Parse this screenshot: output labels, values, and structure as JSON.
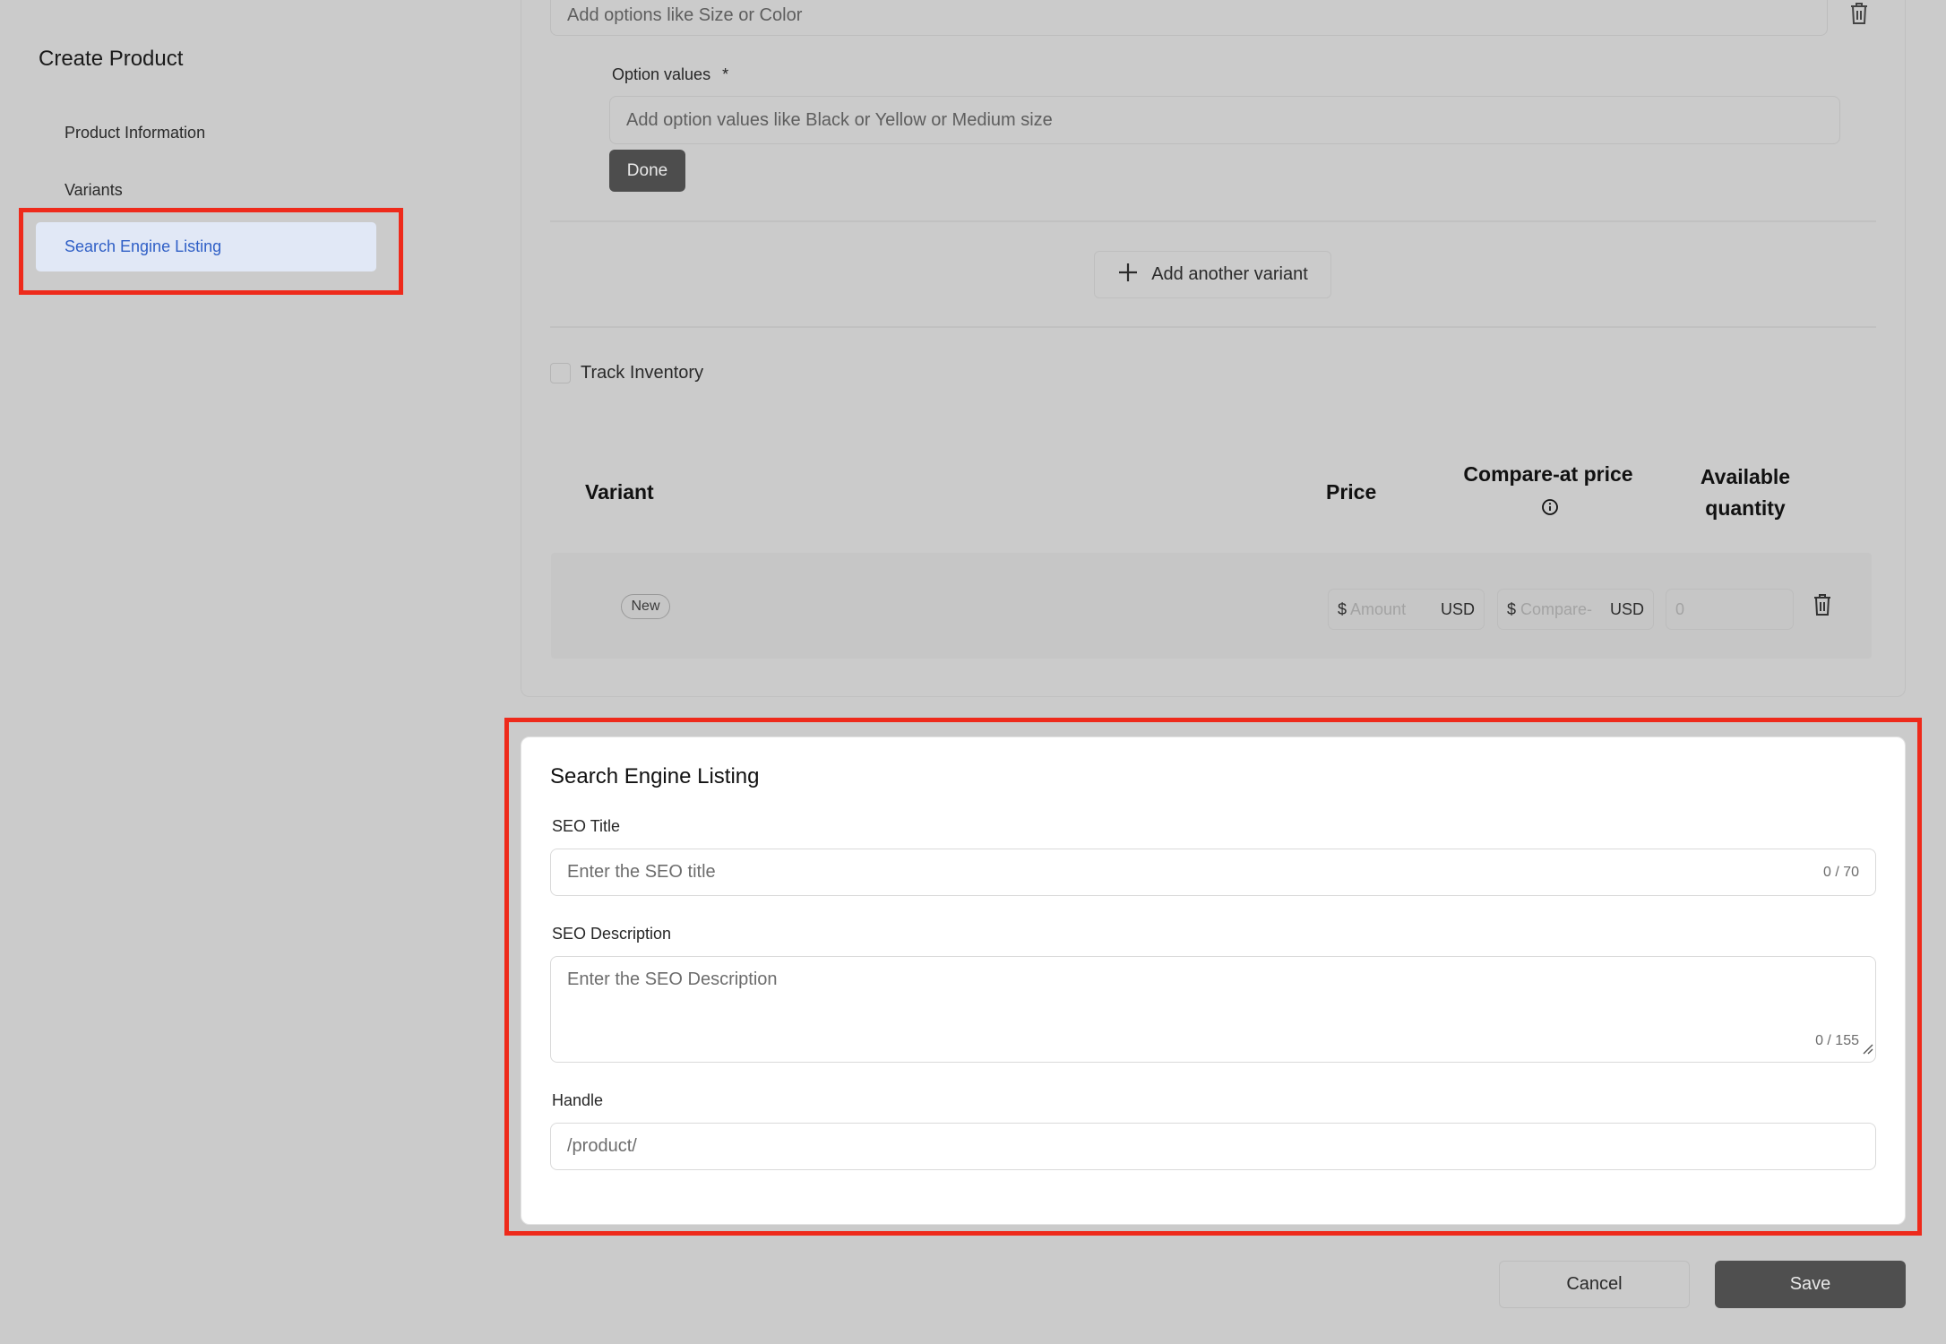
{
  "sidebar": {
    "title": "Create Product",
    "items": [
      {
        "label": "Product Information"
      },
      {
        "label": "Variants"
      },
      {
        "label": "Search Engine Listing"
      }
    ]
  },
  "variant_options": {
    "option_name_placeholder": "Add options like Size or Color",
    "option_values_label": "Option values",
    "required_mark": "*",
    "option_values_placeholder": "Add option values like Black or Yellow or Medium size",
    "done_label": "Done",
    "add_variant_label": "Add another variant"
  },
  "inventory": {
    "track_label": "Track Inventory",
    "checked": false
  },
  "variant_table": {
    "headers": {
      "variant": "Variant",
      "price": "Price",
      "compare_at": "Compare-at price",
      "available_line1": "Available",
      "available_line2": "quantity"
    },
    "row": {
      "badge": "New",
      "currency_symbol": "$",
      "price_placeholder": "Amount",
      "currency": "USD",
      "compare_placeholder": "Compare-",
      "quantity_placeholder": "0"
    }
  },
  "seo": {
    "section_title": "Search Engine Listing",
    "title_label": "SEO Title",
    "title_placeholder": "Enter the SEO title",
    "title_counter": "0 / 70",
    "description_label": "SEO Description",
    "description_placeholder": "Enter the SEO Description",
    "description_counter": "0 / 155",
    "handle_label": "Handle",
    "handle_value": "/product/"
  },
  "footer": {
    "cancel_label": "Cancel",
    "save_label": "Save"
  },
  "colors": {
    "highlight": "#ee2a1b",
    "active_nav": "#2f5fc6",
    "dim_overlay": "#cbcbcb"
  }
}
